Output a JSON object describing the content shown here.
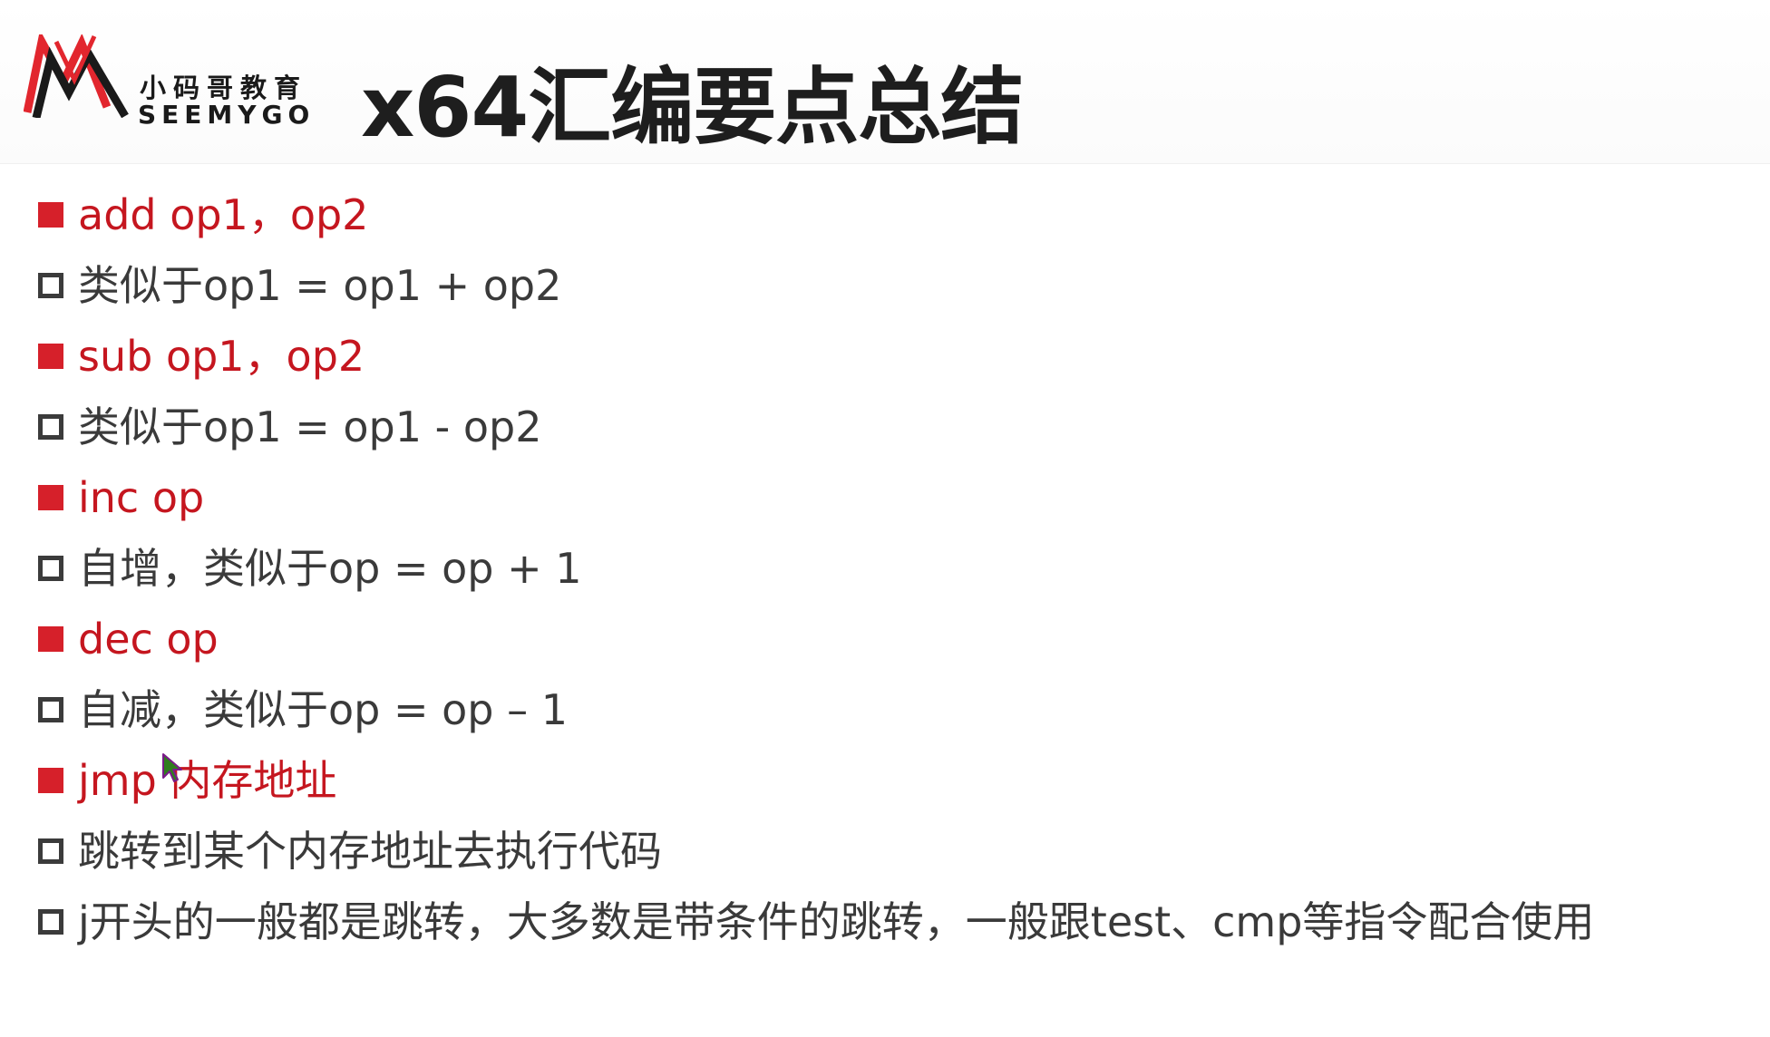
{
  "logo": {
    "cn": "小码哥教育",
    "en": "SEEMYGO",
    "colors": {
      "red": "#e2262e",
      "black": "#1a1a1a"
    }
  },
  "title": "x64汇编要点总结",
  "colors": {
    "accent": "#d6202a",
    "heading_text": "#c5161f",
    "body_text": "#3a3a3a"
  },
  "bullets": [
    {
      "level": 1,
      "text": "add  op1，op2"
    },
    {
      "level": 2,
      "text": "类似于op1 = op1 + op2"
    },
    {
      "level": 1,
      "text": "sub  op1，op2"
    },
    {
      "level": 2,
      "text": "类似于op1 = op1 - op2"
    },
    {
      "level": 1,
      "text": "inc  op"
    },
    {
      "level": 2,
      "text": "自增，类似于op = op + 1"
    },
    {
      "level": 1,
      "text": "dec op"
    },
    {
      "level": 2,
      "text": "自减，类似于op = op – 1"
    },
    {
      "level": 1,
      "text": "jmp 内存地址"
    },
    {
      "level": 2,
      "text": "跳转到某个内存地址去执行代码"
    },
    {
      "level": 2,
      "text": "j开头的一般都是跳转，大多数是带条件的跳转，一般跟test、cmp等指令配合使用"
    }
  ],
  "cursor": {
    "icon": "mouse-pointer-icon"
  }
}
